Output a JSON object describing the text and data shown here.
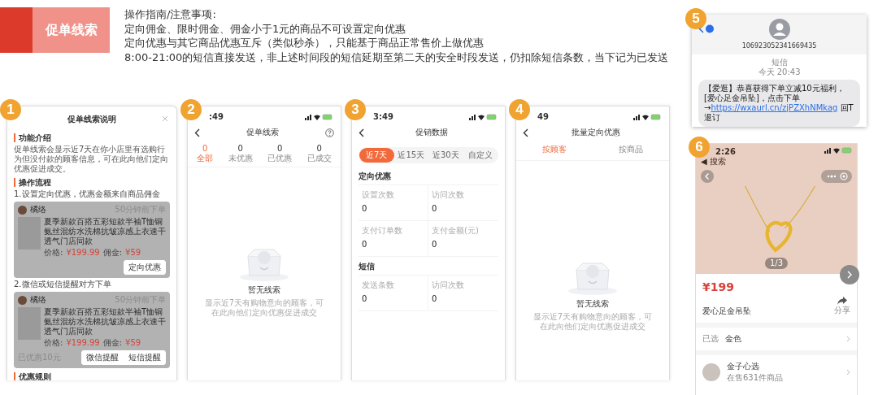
{
  "header": {
    "tag": "促单线索",
    "notes": [
      "操作指南/注意事项:",
      "定向佣金、限时佣金、佣金小于1元的商品不可设置定向优惠",
      "定向优惠与其它商品优惠互斥（类似秒杀），只能基于商品正常售价上做优惠",
      "8:00-21:00的短信直接发送，非上述时间段的短信延期至第二天的安全时段发送，仍扣除短信条数，当下记为已发送"
    ]
  },
  "screens": [
    {
      "kind": "guide",
      "badge": "1",
      "title": "促单线索说明",
      "blocks": [
        {
          "kind": "heading",
          "text": "功能介绍"
        },
        {
          "kind": "paragraph",
          "text": "促单线索会显示近7天在你小店里有选购行为但没付款的顾客信息，可在此向他们定向优惠促进成交。"
        },
        {
          "kind": "heading",
          "text": "操作流程"
        },
        {
          "kind": "step",
          "text": "1.设置定向优惠，优惠金额来自商品佣金"
        },
        {
          "kind": "card",
          "user": "橘络",
          "time": "50分钟前下单",
          "product": "夏季新款百搭五彩短款半袖T恤铜氨丝混纺水洗棉抗皱凉感上衣速干透气门店同款",
          "price_label": "价格:",
          "price": "¥199.99",
          "commission_label": "佣金:",
          "commission": "¥59",
          "buttons": [
            "定向优惠"
          ]
        },
        {
          "kind": "step",
          "text": "2.微信或短信提醒对方下单"
        },
        {
          "kind": "card",
          "user": "橘络",
          "time": "50分钟前下单",
          "product": "夏季新款百搭五彩短款半袖T恤铜氨丝混纺水洗棉抗皱凉感上衣速干透气门店同款",
          "price_label": "价格:",
          "price": "¥199.99",
          "commission_label": "佣金:",
          "commission": "¥59",
          "note": "已优惠10元",
          "buttons": [
            "微信提醒",
            "短信提醒"
          ]
        },
        {
          "kind": "heading",
          "text": "优惠规则"
        }
      ]
    },
    {
      "kind": "leads",
      "badge": "2",
      "time": ":49",
      "title": "促单线索",
      "tabs": [
        {
          "count": "0",
          "label": "全部",
          "selected": true
        },
        {
          "count": "0",
          "label": "未优惠",
          "selected": false
        },
        {
          "count": "0",
          "label": "已优惠",
          "selected": false
        },
        {
          "count": "0",
          "label": "已成交",
          "selected": false
        }
      ],
      "empty": {
        "title": "暂无线索",
        "text": "显示近7天有购物意向的顾客，可在此向他们定向优惠促进成交"
      }
    },
    {
      "kind": "stats",
      "badge": "3",
      "time": "3:49",
      "title": "促销数据",
      "ranges": [
        {
          "label": "近7天",
          "selected": true
        },
        {
          "label": "近15天",
          "selected": false
        },
        {
          "label": "近30天",
          "selected": false
        },
        {
          "label": "自定义",
          "selected": false
        }
      ],
      "sections": [
        {
          "title": "定向优惠",
          "stats": [
            {
              "label": "设置次数",
              "value": "0"
            },
            {
              "label": "访问次数",
              "value": "0"
            },
            {
              "label": "支付订单数",
              "value": "0"
            },
            {
              "label": "支付金额(元)",
              "value": "0"
            }
          ]
        },
        {
          "title": "短信",
          "stats": [
            {
              "label": "发送条数",
              "value": "0"
            },
            {
              "label": "访问次数",
              "value": "0"
            }
          ]
        }
      ]
    },
    {
      "kind": "batch",
      "badge": "4",
      "time": "49",
      "title": "批量定向优惠",
      "tabs": [
        {
          "label": "按顾客",
          "selected": true
        },
        {
          "label": "按商品",
          "selected": false
        }
      ],
      "empty": {
        "title": "暂无线索",
        "text": "显示近7天有购物意向的顾客，可在此向他们定向优惠促进成交"
      }
    },
    {
      "kind": "sms",
      "badge": "5",
      "sender": "106923052341669435",
      "meta": "短信",
      "time": "今天 20:43",
      "message": "【爱逛】恭喜获得下单立减10元福利，[爱心足金吊坠]，点击下单 →",
      "link": "https://wxaurl.cn/zjPZXhNMkag",
      "suffix": "回T退订"
    },
    {
      "kind": "product",
      "badge": "6",
      "time": "2:26",
      "back_label": "◀ 搜索",
      "photo_counter": "1/3",
      "price": "¥199",
      "name": "爱心足金吊坠",
      "share": "分享",
      "spec_label": "已选",
      "spec_value": "金色",
      "shop": "金子心选",
      "shop_info": "在售631件商品"
    }
  ]
}
